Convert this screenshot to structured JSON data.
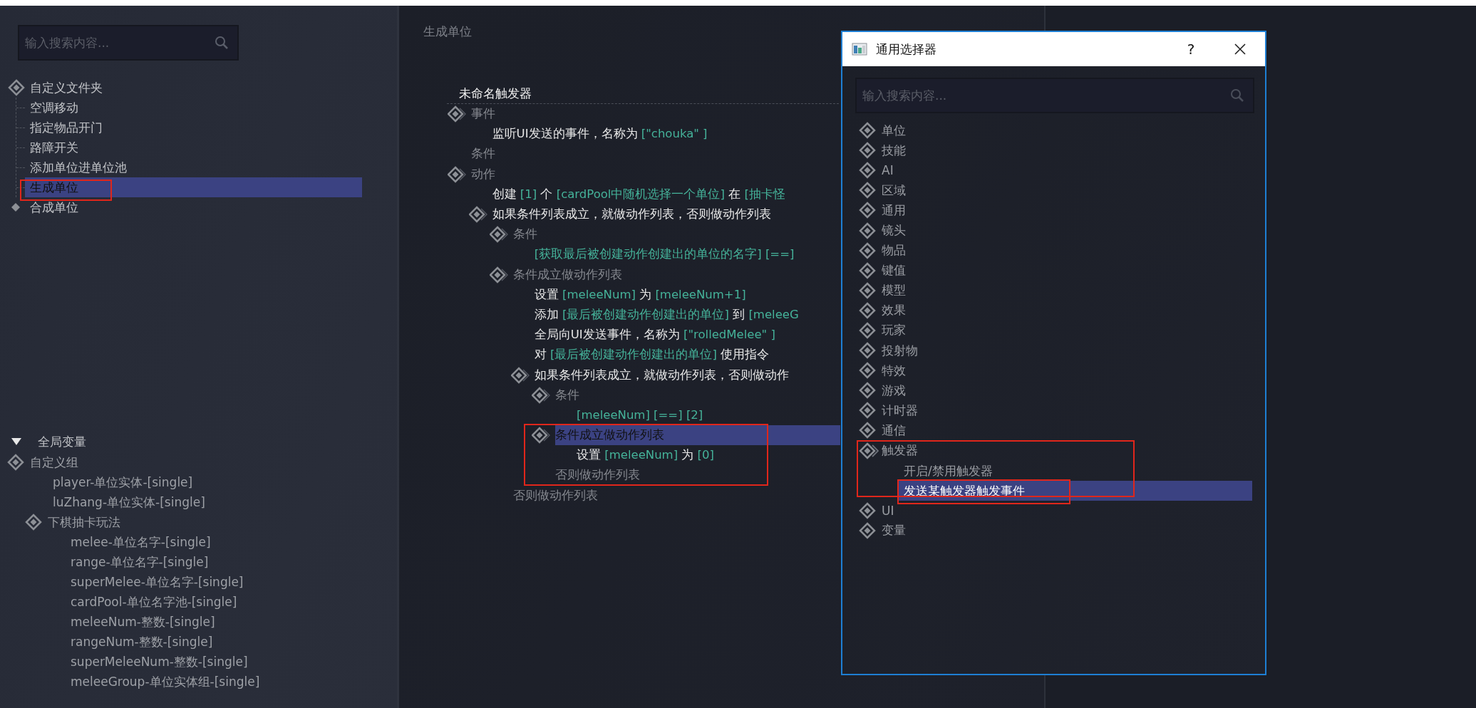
{
  "search": {
    "placeholder": "输入搜索内容..."
  },
  "folder_tree": [
    {
      "kind": "folder",
      "label": "自定义文件夹",
      "expanded": true,
      "selected": false,
      "children": [
        {
          "label": "空调移动",
          "selected": false
        },
        {
          "label": "指定物品开门",
          "selected": false
        },
        {
          "label": "路障开关",
          "selected": false
        },
        {
          "label": "添加单位进单位池",
          "selected": false
        },
        {
          "label": "生成单位",
          "selected": true
        }
      ]
    },
    {
      "kind": "leaf",
      "label": "合成单位",
      "selected": false
    }
  ],
  "global_vars": {
    "title": "全局变量",
    "expanded": true,
    "items": [
      {
        "kind": "group",
        "label": "自定义组",
        "children": [
          {
            "kind": "var",
            "label": "player-单位实体-[single]"
          },
          {
            "kind": "var",
            "label": "luZhang-单位实体-[single]"
          },
          {
            "kind": "group",
            "label": "下棋抽卡玩法",
            "children": [
              {
                "kind": "var",
                "label": "melee-单位名字-[single]"
              },
              {
                "kind": "var",
                "label": "range-单位名字-[single]"
              },
              {
                "kind": "var",
                "label": "superMelee-单位名字-[single]"
              },
              {
                "kind": "var",
                "label": "cardPool-单位名字池-[single]"
              },
              {
                "kind": "var",
                "label": "meleeNum-整数-[single]"
              },
              {
                "kind": "var",
                "label": "rangeNum-整数-[single]"
              },
              {
                "kind": "var",
                "label": "superMeleeNum-整数-[single]"
              },
              {
                "kind": "var",
                "label": "meleeGroup-单位实体组-[single]"
              }
            ]
          }
        ]
      }
    ]
  },
  "editor": {
    "title": "生成单位",
    "trigger_name": "未命名触发器",
    "lines": [
      {
        "kind": "section",
        "label": "事件",
        "selected": false,
        "children": [
          {
            "kind": "statement",
            "selected": false,
            "parts": [
              {
                "kind": "word",
                "text": "监听UI发送的事件，名称为"
              },
              {
                "kind": "value",
                "text": "[\"chouka\" ]"
              }
            ]
          }
        ]
      },
      {
        "kind": "label",
        "label": "条件",
        "selected": false
      },
      {
        "kind": "section",
        "label": "动作",
        "selected": false,
        "children": [
          {
            "kind": "statement",
            "selected": false,
            "parts": [
              {
                "kind": "word",
                "text": "创建"
              },
              {
                "kind": "value",
                "text": "[1]"
              },
              {
                "kind": "word",
                "text": "个"
              },
              {
                "kind": "value",
                "text": "[cardPool中随机选择一个单位]"
              },
              {
                "kind": "word",
                "text": "在"
              },
              {
                "kind": "value",
                "text": "[抽卡怪"
              }
            ]
          },
          {
            "kind": "block",
            "label": "如果条件列表成立，就做动作列表，否则做动作列表",
            "selected": false,
            "children": [
              {
                "kind": "section",
                "label": "条件",
                "selected": false,
                "children": [
                  {
                    "kind": "statement",
                    "selected": false,
                    "parts": [
                      {
                        "kind": "value",
                        "text": "[获取最后被创建动作创建出的单位的名字]"
                      },
                      {
                        "kind": "value",
                        "text": "[==]"
                      }
                    ]
                  }
                ]
              },
              {
                "kind": "section",
                "label": "条件成立做动作列表",
                "selected": false,
                "children": [
                  {
                    "kind": "statement",
                    "selected": false,
                    "parts": [
                      {
                        "kind": "word",
                        "text": "设置"
                      },
                      {
                        "kind": "value",
                        "text": "[meleeNum]"
                      },
                      {
                        "kind": "word",
                        "text": "为"
                      },
                      {
                        "kind": "value",
                        "text": "[meleeNum+1]"
                      }
                    ]
                  },
                  {
                    "kind": "statement",
                    "selected": false,
                    "parts": [
                      {
                        "kind": "word",
                        "text": "添加"
                      },
                      {
                        "kind": "value",
                        "text": "[最后被创建动作创建出的单位]"
                      },
                      {
                        "kind": "word",
                        "text": "到"
                      },
                      {
                        "kind": "value",
                        "text": "[meleeG"
                      }
                    ]
                  },
                  {
                    "kind": "statement",
                    "selected": false,
                    "parts": [
                      {
                        "kind": "word",
                        "text": "全局向UI发送事件，名称为"
                      },
                      {
                        "kind": "value",
                        "text": "[\"rolledMelee\" ]"
                      }
                    ]
                  },
                  {
                    "kind": "statement",
                    "selected": false,
                    "parts": [
                      {
                        "kind": "word",
                        "text": "对"
                      },
                      {
                        "kind": "value",
                        "text": "[最后被创建动作创建出的单位]"
                      },
                      {
                        "kind": "word",
                        "text": "使用指令"
                      }
                    ]
                  },
                  {
                    "kind": "block",
                    "label": "如果条件列表成立，就做动作列表，否则做动作",
                    "selected": false,
                    "children": [
                      {
                        "kind": "section",
                        "label": "条件",
                        "selected": false,
                        "children": [
                          {
                            "kind": "statement",
                            "selected": false,
                            "parts": [
                              {
                                "kind": "value",
                                "text": "[meleeNum]"
                              },
                              {
                                "kind": "value",
                                "text": "[==]"
                              },
                              {
                                "kind": "value",
                                "text": "[2]"
                              }
                            ]
                          }
                        ]
                      },
                      {
                        "kind": "section",
                        "label": "条件成立做动作列表",
                        "selected": true,
                        "children": [
                          {
                            "kind": "statement",
                            "selected": false,
                            "parts": [
                              {
                                "kind": "word",
                                "text": "设置"
                              },
                              {
                                "kind": "value",
                                "text": "[meleeNum]"
                              },
                              {
                                "kind": "word",
                                "text": "为"
                              },
                              {
                                "kind": "value",
                                "text": "[0]"
                              }
                            ]
                          }
                        ]
                      },
                      {
                        "kind": "label",
                        "label": "否则做动作列表",
                        "selected": false
                      }
                    ]
                  }
                ]
              },
              {
                "kind": "label",
                "label": "否则做动作列表",
                "selected": false
              }
            ]
          }
        ]
      }
    ]
  },
  "dialog": {
    "title": "通用选择器",
    "help_button": "?",
    "search": {
      "placeholder": "输入搜索内容..."
    },
    "items": [
      {
        "label": "单位",
        "expanded": false,
        "selected": false
      },
      {
        "label": "技能",
        "expanded": false,
        "selected": false
      },
      {
        "label": "AI",
        "expanded": false,
        "selected": false
      },
      {
        "label": "区域",
        "expanded": false,
        "selected": false
      },
      {
        "label": "通用",
        "expanded": false,
        "selected": false
      },
      {
        "label": "镜头",
        "expanded": false,
        "selected": false
      },
      {
        "label": "物品",
        "expanded": false,
        "selected": false
      },
      {
        "label": "键值",
        "expanded": false,
        "selected": false
      },
      {
        "label": "模型",
        "expanded": false,
        "selected": false
      },
      {
        "label": "效果",
        "expanded": false,
        "selected": false
      },
      {
        "label": "玩家",
        "expanded": false,
        "selected": false
      },
      {
        "label": "投射物",
        "expanded": false,
        "selected": false
      },
      {
        "label": "特效",
        "expanded": false,
        "selected": false
      },
      {
        "label": "游戏",
        "expanded": false,
        "selected": false
      },
      {
        "label": "计时器",
        "expanded": false,
        "selected": false
      },
      {
        "label": "通信",
        "expanded": false,
        "selected": false
      },
      {
        "label": "触发器",
        "expanded": true,
        "selected": false,
        "children": [
          {
            "label": "开启/禁用触发器",
            "selected": false
          },
          {
            "label": "发送某触发器触发事件",
            "selected": true
          }
        ]
      },
      {
        "label": "UI",
        "expanded": false,
        "selected": false
      },
      {
        "label": "变量",
        "expanded": false,
        "selected": false
      }
    ]
  }
}
